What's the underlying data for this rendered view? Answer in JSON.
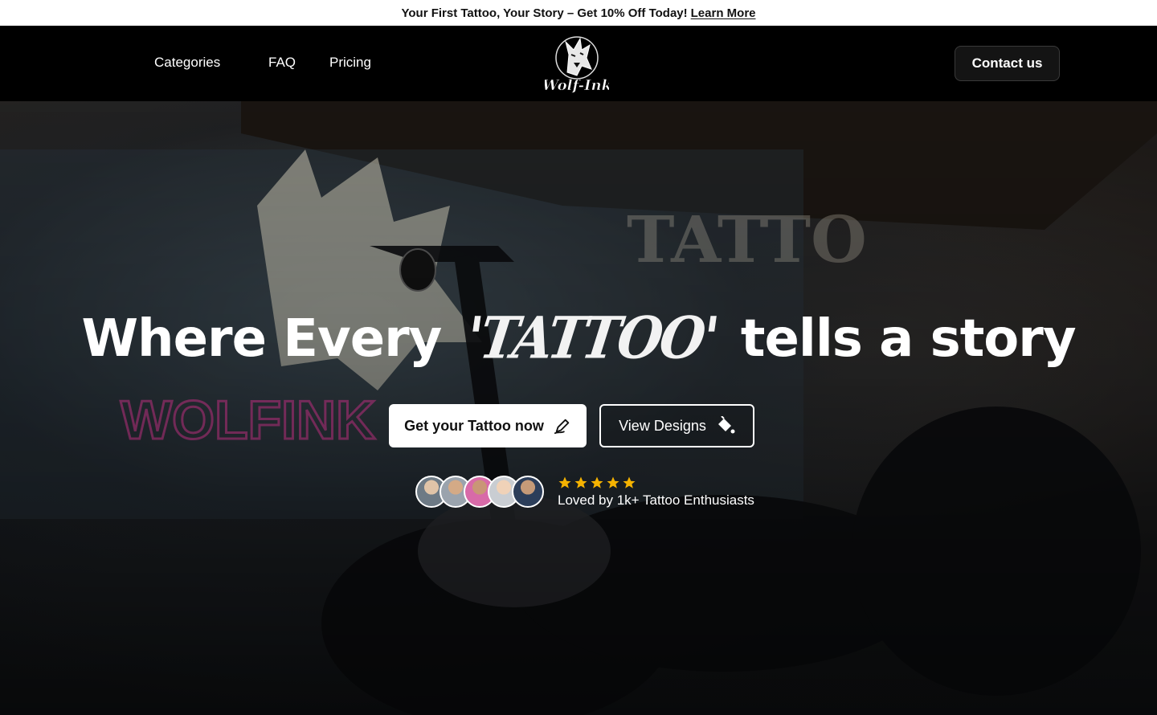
{
  "announcement": {
    "text": "Your First Tattoo, Your Story – Get 10% Off Today!",
    "link": "Learn More"
  },
  "nav": {
    "links": [
      "Categories",
      "FAQ",
      "Pricing"
    ],
    "logo_text": "Wolf-Ink",
    "contact_label": "Contact us"
  },
  "hero": {
    "headline_before": "Where Every",
    "headline_highlight": "'TATTOO'",
    "headline_after": "tells a story",
    "primary_cta": "Get your Tattoo now",
    "secondary_cta": "View Designs",
    "rating_stars": 5,
    "social_proof": "Loved by 1k+ Tattoo Enthusiasts"
  },
  "colors": {
    "announcement_bg": "#ffffff",
    "nav_bg": "#000000",
    "star": "#f5b301"
  },
  "icons": {
    "primary_cta": "pen-icon",
    "secondary_cta": "paint-bucket-icon",
    "rating": "star-icon"
  }
}
